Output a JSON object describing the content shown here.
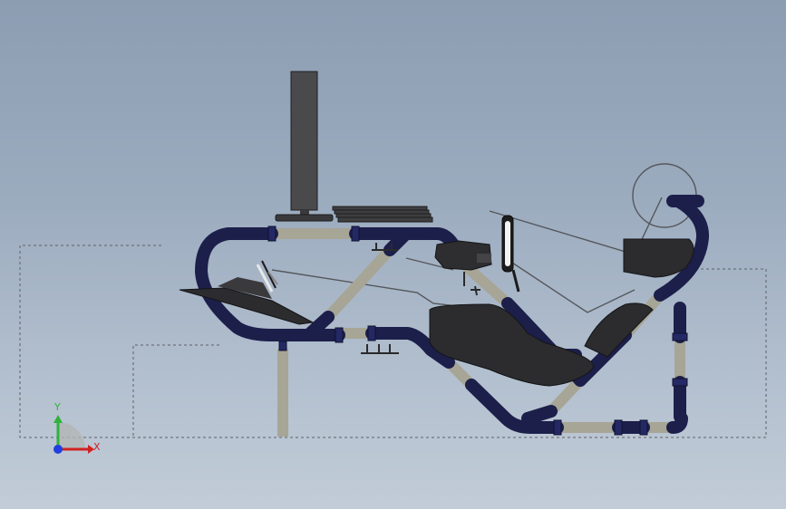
{
  "viewport": {
    "background_top": "#8c9db2",
    "background_bottom": "#c2ccd8"
  },
  "model": {
    "tube_color": "#1c1f4a",
    "strut_color": "#a7a596",
    "seat_color": "#2c2c2f",
    "monitor_color": "#4a4a4d",
    "sketch_line_color": "#55575c"
  },
  "triad": {
    "x_label": "X",
    "y_label": "Y",
    "x_color": "#d02222",
    "y_color": "#2fb33a",
    "z_color": "#1f3fe0"
  }
}
